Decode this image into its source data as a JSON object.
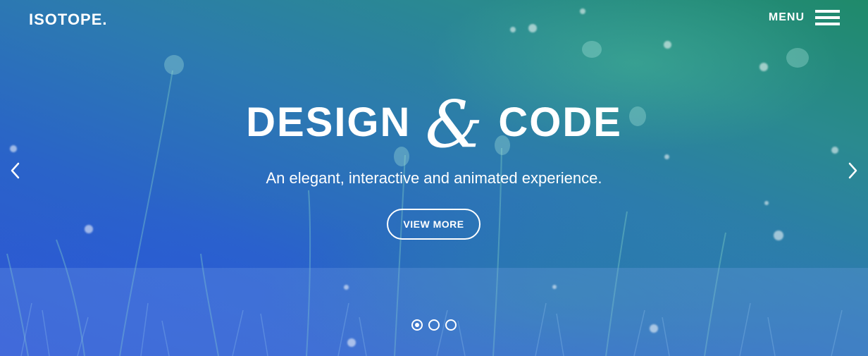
{
  "brand": {
    "logo_text": "ISOTOPE."
  },
  "header": {
    "menu_label": "MENU"
  },
  "hero": {
    "headline_left": "DESIGN",
    "headline_amp": "&",
    "headline_right": "CODE",
    "tagline": "An elegant, interactive and animated experience.",
    "cta_label": "VIEW MORE"
  },
  "slider": {
    "total_slides": 3,
    "active_slide": 1
  },
  "icons": {
    "hamburger": "hamburger-menu-icon",
    "prev": "chevron-left-icon",
    "next": "chevron-right-icon"
  },
  "colors": {
    "gradient_top_right": "#1f8a6a",
    "gradient_bottom_left": "#2e54d6",
    "text": "#ffffff"
  }
}
